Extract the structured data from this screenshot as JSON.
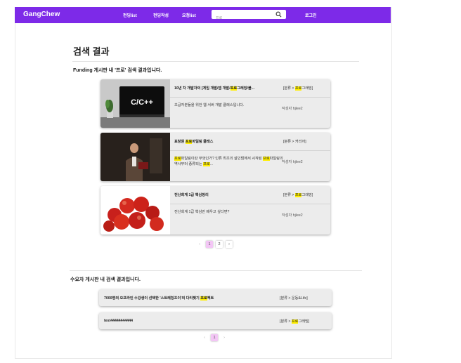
{
  "header": {
    "brand": "GangChew",
    "nav": [
      "펀딩list",
      "펀딩작성",
      "요청list"
    ],
    "search_value": "프로",
    "login": "로그인"
  },
  "page_title": "검색 결과",
  "funding": {
    "section_heading": "Funding 게시판 내 '프로' 검색 결과입니다.",
    "cards": [
      {
        "title_parts": [
          "10년 차 개발자의 [게임 개발/앱 개발/",
          "프로",
          "그래밍/볼..."
        ],
        "category_parts": [
          "[분류 > ",
          "프로",
          "그래밍]"
        ],
        "desc_parts": [
          "초급자분들을 위한 웹 서버 개발 클래스입니다."
        ],
        "author": "작성자 hjlee2",
        "thumb_text": "C/C++"
      },
      {
        "title_parts": [
          "표창원 ",
          "프로",
          "파일링 클래스"
        ],
        "category_parts": [
          "[분류 > 커리어]"
        ],
        "desc_parts": [
          "",
          "프로",
          "파일링이란 무엇인가? 인류 최초의 살인범에서 시작된 ",
          "프로",
          "파일링의 역사부터 종류되는 ",
          "프로",
          "..."
        ],
        "author": "작성자 hjlee2"
      },
      {
        "title_parts": [
          "전산회계 1급 핵심정리"
        ],
        "category_parts": [
          "[분류 > ",
          "프로",
          "그래밍]"
        ],
        "desc_parts": [
          "전산회계 1급 핵심만 배우고 싶다면?"
        ],
        "author": "작성자 hjlee2"
      }
    ],
    "pagination": [
      "‹",
      "1",
      "2",
      "›"
    ],
    "active_page": "1"
  },
  "requests": {
    "section_heading": "수요자 게시판 내 검색 결과입니다.",
    "rows": [
      {
        "title_parts": [
          "7000명의 오프라인 수강생이 선택한 '스트레칭조이'의 다리찢기 ",
          "프로",
          "젝트"
        ],
        "category_parts": [
          "[분류 > 운동&Life]"
        ]
      },
      {
        "title_parts": [
          "test44444444444"
        ],
        "category_parts": [
          "[분류 > ",
          "프로",
          "그래밍]"
        ]
      }
    ],
    "pagination": [
      "‹",
      "1",
      "›"
    ],
    "active_page": "1"
  },
  "colors": {
    "nav_bg": "#7d2ae8",
    "highlight": "#ffee00",
    "active_page": "#f3c6f5"
  }
}
